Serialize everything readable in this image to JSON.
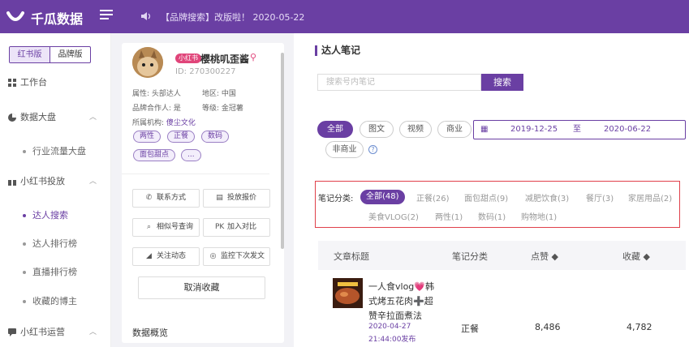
{
  "header": {
    "brand": "千瓜数据",
    "notice": "【品牌搜索】改版啦！ 2020-05-22"
  },
  "sidebar": {
    "segments": [
      "红书版",
      "品牌版"
    ],
    "items": [
      {
        "label": "工作台",
        "icon": "grid-icon"
      },
      {
        "label": "数据大盘",
        "icon": "pie-chart-icon",
        "chevron": "︿"
      },
      {
        "label": "小红书投放",
        "icon": "gift-icon",
        "chevron": "︿"
      },
      {
        "label": "小红书运营",
        "icon": "chat-icon",
        "chevron": "︿"
      }
    ],
    "subitems": [
      "行业流量大盘",
      "达人搜索",
      "达人排行榜",
      "直播排行榜",
      "收藏的博主"
    ]
  },
  "profile": {
    "badge": "小红书",
    "name": "樱桃叽歪酱",
    "id": "ID: 270300227",
    "attr_type": "属性: 头部达人",
    "region": "地区: 中国",
    "brand_partner": "品牌合作人: 是",
    "level": "等级: 金冠薯",
    "agency_label": "所属机构:",
    "agency": "傻尘文化",
    "tags": [
      "两性",
      "正餐",
      "数码",
      "面包甜点",
      "..."
    ],
    "actions": [
      {
        "label": "联系方式",
        "icon": "phone-icon"
      },
      {
        "label": "投放报价",
        "icon": "document-icon"
      },
      {
        "label": "相似号查询",
        "icon": "search-icon"
      },
      {
        "label": "加入对比",
        "icon": "pk-icon",
        "prefix": "PK"
      },
      {
        "label": "关注动态",
        "icon": "chart-icon"
      },
      {
        "label": "监控下次发文",
        "icon": "monitor-icon"
      }
    ],
    "cancel_label": "取消收藏",
    "section_title": "数据概览"
  },
  "main": {
    "title": "达人笔记",
    "search_placeholder": "搜索号内笔记",
    "search_button": "搜索",
    "filters": [
      "全部",
      "图文",
      "视频",
      "商业"
    ],
    "filter_extra": "非商业",
    "date_start": "2019-12-25",
    "date_sep": "至",
    "date_end": "2020-06-22",
    "help": "?",
    "cat_label": "笔记分类:",
    "categories_row1": [
      "全部(48)",
      "正餐(26)",
      "面包甜点(9)",
      "减肥饮食(3)",
      "餐厅(3)",
      "家居用品(2)"
    ],
    "categories_row2": [
      "美食VLOG(2)",
      "两性(1)",
      "数码(1)",
      "购物地(1)"
    ],
    "table_headers": [
      "文章标题",
      "笔记分类",
      "点赞 ◆",
      "收藏 ◆"
    ],
    "row": {
      "title": "一人食vlog💗韩式烤五花肉➕超赞辛拉面煮法",
      "date": "2020-04-27 21:44:00发布",
      "category": "正餐",
      "likes": "8,486",
      "collects": "4,782"
    }
  },
  "colors": {
    "accent": "#6a3fa3",
    "alert_border": "#e0404a",
    "badge": "#e0457a"
  }
}
